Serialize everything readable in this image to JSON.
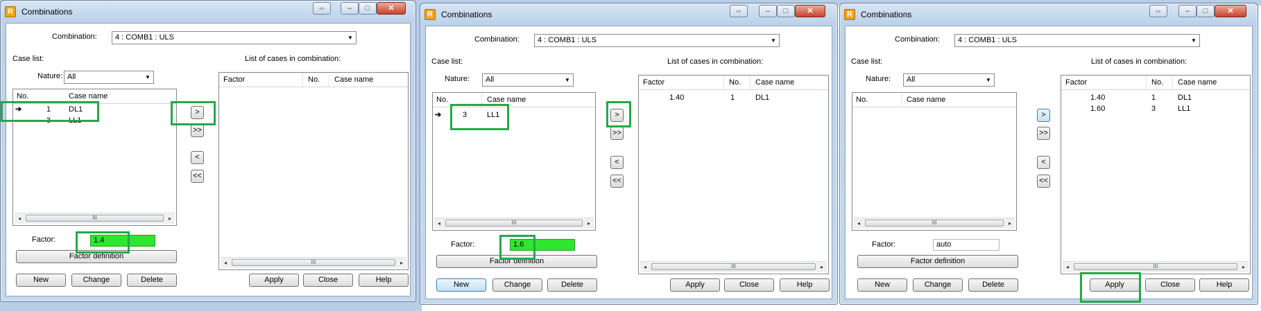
{
  "windows": [
    {
      "title": "Combinations",
      "combination_label": "Combination:",
      "combination_value": "4 : COMB1 : ULS",
      "case_list_label": "Case list:",
      "nature_label": "Nature:",
      "nature_value": "All",
      "case_columns": [
        "No.",
        "Case name"
      ],
      "case_rows": [
        {
          "no": "1",
          "name": "DL1"
        },
        {
          "no": "3",
          "name": "LL1"
        }
      ],
      "list_cases_label": "List of cases in combination:",
      "combo_columns": [
        "Factor",
        "No.",
        "Case name"
      ],
      "combo_rows": [],
      "factor_label": "Factor:",
      "factor_value": "1.4",
      "factor_def_button": "Factor definition",
      "move_buttons": [
        ">",
        ">>",
        "<",
        "<<"
      ],
      "bottom_buttons": [
        "New",
        "Change",
        "Delete",
        "Apply",
        "Close",
        "Help"
      ]
    },
    {
      "title": "Combinations",
      "combination_label": "Combination:",
      "combination_value": "4 : COMB1 : ULS",
      "case_list_label": "Case list:",
      "nature_label": "Nature:",
      "nature_value": "All",
      "case_columns": [
        "No.",
        "Case name"
      ],
      "case_rows": [
        {
          "no": "3",
          "name": "LL1"
        }
      ],
      "list_cases_label": "List of cases in combination:",
      "combo_columns": [
        "Factor",
        "No.",
        "Case name"
      ],
      "combo_rows": [
        {
          "factor": "1.40",
          "no": "1",
          "name": "DL1"
        }
      ],
      "factor_label": "Factor:",
      "factor_value": "1.6",
      "factor_def_button": "Factor definition",
      "move_buttons": [
        ">",
        ">>",
        "<",
        "<<"
      ],
      "bottom_buttons": [
        "New",
        "Change",
        "Delete",
        "Apply",
        "Close",
        "Help"
      ]
    },
    {
      "title": "Combinations",
      "combination_label": "Combination:",
      "combination_value": "4 : COMB1 : ULS",
      "case_list_label": "Case list:",
      "nature_label": "Nature:",
      "nature_value": "All",
      "case_columns": [
        "No.",
        "Case name"
      ],
      "case_rows": [],
      "list_cases_label": "List of cases in combination:",
      "combo_columns": [
        "Factor",
        "No.",
        "Case name"
      ],
      "combo_rows": [
        {
          "factor": "1.40",
          "no": "1",
          "name": "DL1"
        },
        {
          "factor": "1.60",
          "no": "3",
          "name": "LL1"
        }
      ],
      "factor_label": "Factor:",
      "factor_value": "auto",
      "factor_def_button": "Factor definition",
      "move_buttons": [
        ">",
        ">>",
        "<",
        "<<"
      ],
      "bottom_buttons": [
        "New",
        "Change",
        "Delete",
        "Apply",
        "Close",
        "Help"
      ]
    }
  ],
  "icons": {
    "app_icon_glyph": "R",
    "restore_glyph": "⇔",
    "minimize_glyph": "–",
    "maximize_glyph": "□",
    "close_glyph": "✕",
    "dropdown_glyph": "▼",
    "selected_row_glyph": "➔",
    "scroll_left_glyph": "◂",
    "scroll_right_glyph": "▸",
    "scroll_thumb_glyph": "III"
  },
  "colors": {
    "highlight_green": "#23a84a",
    "factor_fill_green": "#2ee62e",
    "window_frame": "#bed3ea"
  }
}
